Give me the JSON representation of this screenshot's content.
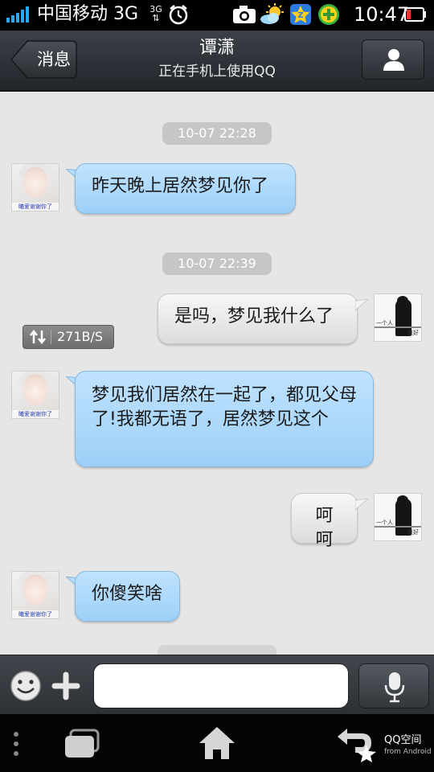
{
  "status_bar": {
    "carrier": "中国移动 3G",
    "network_mini": "3G",
    "clock": "10:47",
    "icons": [
      "signal-icon",
      "alarm-icon",
      "camera-icon",
      "weather-icon",
      "qzone-app-icon",
      "security-app-icon",
      "battery-icon"
    ],
    "battery_color": "#e53935"
  },
  "header": {
    "back_label": "消息",
    "title": "谭潇",
    "subtitle": "正在手机上使用QQ"
  },
  "chat": {
    "timestamps": [
      "10-07 22:28",
      "10-07 22:39"
    ],
    "messages": [
      {
        "side": "in",
        "text": "昨天晚上居然梦见你了"
      },
      {
        "side": "out",
        "text": "是吗，梦见我什么了"
      },
      {
        "side": "in",
        "text": "梦见我们居然在一起了，都见父母了!我都无语了，居然梦见这个"
      },
      {
        "side": "out",
        "text": "呵呵"
      },
      {
        "side": "in",
        "text": "你傻笑啥"
      }
    ],
    "speed": "271B/S",
    "avatar_left_caption": "曦爱谢谢你了",
    "avatar_right_caption_1": "一个人",
    "avatar_right_caption_2": "很好"
  },
  "input_bar": {
    "placeholder": ""
  },
  "nav_bar": {
    "qzone_label": "QQ空间",
    "qzone_sub": "from Android"
  },
  "colors": {
    "incoming_bubble": "#a9d6fa",
    "outgoing_bubble": "#e8e8e8",
    "background": "#e6e6e6"
  }
}
